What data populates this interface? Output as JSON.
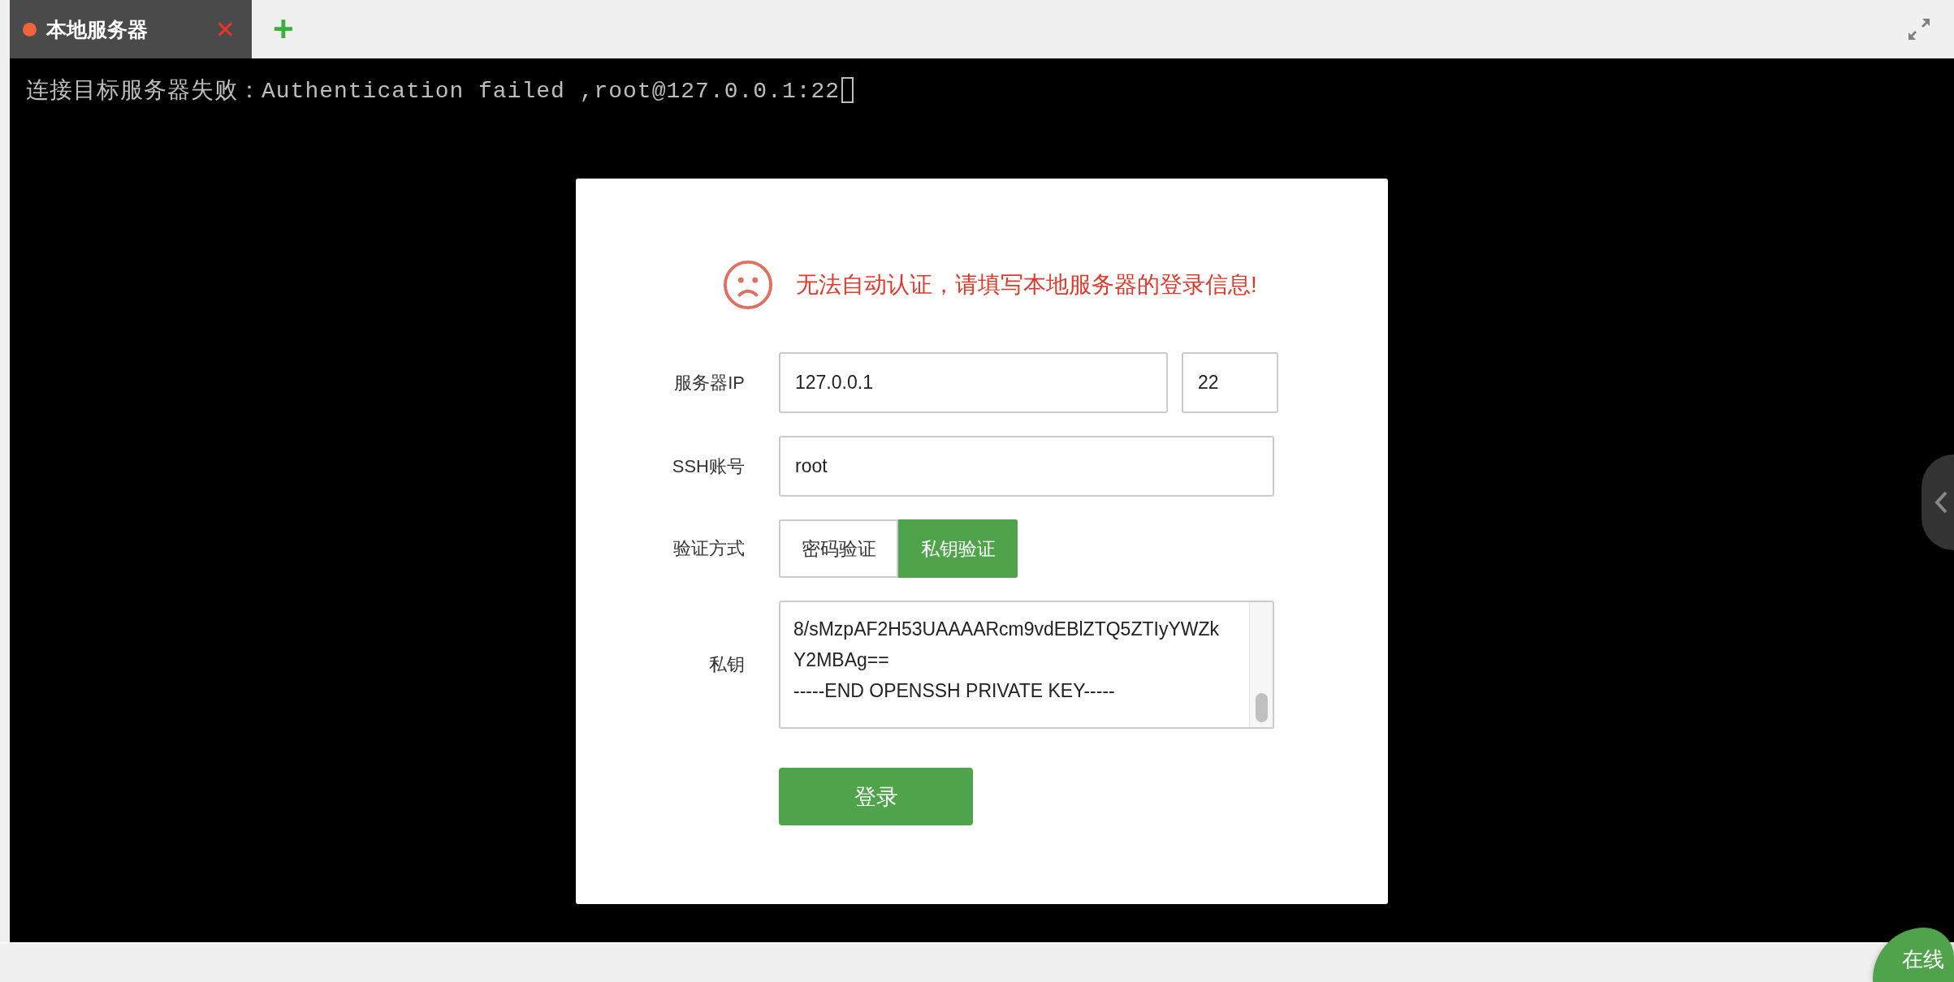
{
  "tabs": [
    {
      "label": "本地服务器",
      "selected": true,
      "color": "#f0643c",
      "close": "✕"
    }
  ],
  "add_tab": "+",
  "terminal": {
    "line": "连接目标服务器失败：Authentication failed ,root@127.0.0.1:22"
  },
  "dialog": {
    "message": "无法自动认证，请填写本地服务器的登录信息!",
    "fields": [
      {
        "label": "服务器IP",
        "value": "127.0.0.1",
        "port": "22"
      },
      {
        "label": "SSH账号",
        "value": "root"
      }
    ],
    "auth": {
      "label": "验证方式",
      "options": [
        {
          "label": "密码验证",
          "selected": false
        },
        {
          "label": "私钥验证",
          "selected": true
        }
      ]
    },
    "key": {
      "label": "私钥",
      "lines": [
        "8/sMzpAF2H53UAAAARcm9vdEBlZTQ5ZTIyYWZk",
        "Y2MBAg==",
        "-----END OPENSSH PRIVATE KEY-----"
      ]
    },
    "submit": "登录"
  },
  "support_button": "在线"
}
